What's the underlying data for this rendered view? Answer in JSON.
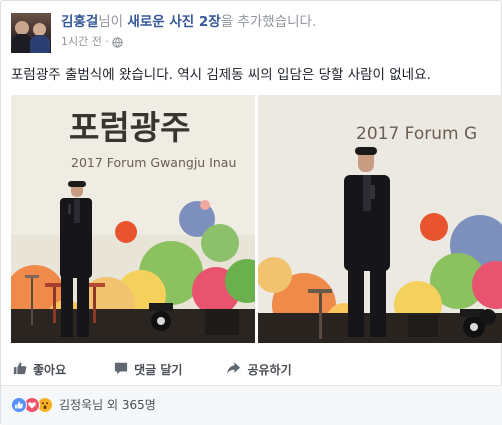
{
  "post": {
    "author": "김홍걸",
    "verb_prefix": "님이 ",
    "photos_link": "새로운 사진 2장",
    "verb_suffix": "을 추가했습니다.",
    "timestamp": "1시간 전 ·",
    "privacy_icon": "globe-icon",
    "text": "포럼광주 출범식에 왔습니다. 역시 김제동 씨의 입담은 당할 사람이 없네요."
  },
  "photos": [
    {
      "banner_title": "포럼광주",
      "banner_subtitle": "2017 Forum Gwangju Inau"
    },
    {
      "banner_title": "",
      "banner_subtitle": "2017 Forum G"
    }
  ],
  "actions": {
    "like": "좋아요",
    "comment": "댓글 달기",
    "share": "공유하기"
  },
  "reactions": {
    "icons": [
      "like-reaction-icon",
      "love-reaction-icon",
      "wow-reaction-icon"
    ],
    "summary": "김정욱님 외 365명"
  },
  "colors": {
    "link": "#365899",
    "meta": "#90949c",
    "action_text": "#4b4f56",
    "like_blue": "#5890ff",
    "love_red": "#f25268",
    "wow_yellow": "#f7b125"
  }
}
